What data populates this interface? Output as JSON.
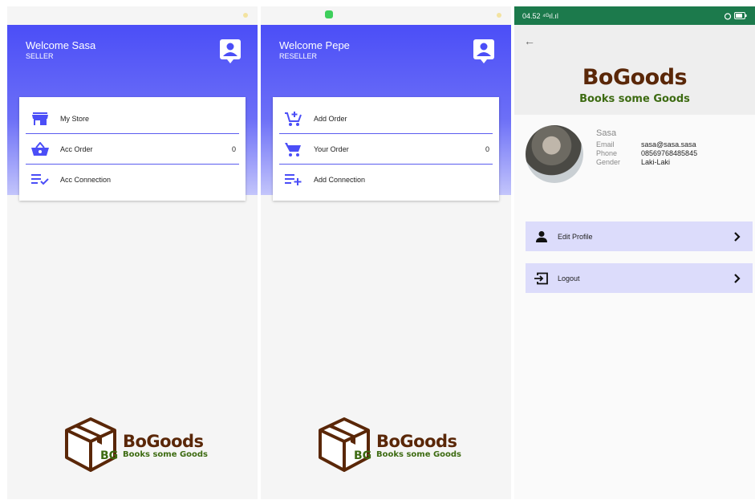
{
  "seller_screen": {
    "welcome": "Welcome Sasa",
    "role": "SELLER",
    "menu": [
      {
        "label": "My Store",
        "icon": "store-icon"
      },
      {
        "label": "Acc Order",
        "icon": "basket-icon",
        "count": "0"
      },
      {
        "label": "Acc Connection",
        "icon": "playlist-check-icon"
      }
    ]
  },
  "reseller_screen": {
    "welcome": "Welcome Pepe",
    "role": "RESELLER",
    "menu": [
      {
        "label": "Add Order",
        "icon": "cart-plus-icon"
      },
      {
        "label": "Your Order",
        "icon": "cart-icon",
        "count": "0"
      },
      {
        "label": "Add Connection",
        "icon": "playlist-add-icon"
      }
    ]
  },
  "logo": {
    "brand": "BoGoods",
    "tagline": "Books some Goods",
    "box_letters": "BG"
  },
  "profile_screen": {
    "status_time": "04.52",
    "status_signal": "⁴ᴳıl.ıl",
    "brand": "BoGoods",
    "tagline": "Books some Goods",
    "name": "Sasa",
    "fields": [
      {
        "label": "Email",
        "value": "sasa@sasa.sasa"
      },
      {
        "label": "Phone",
        "value": "08569768485845"
      },
      {
        "label": "Gender",
        "value": "Laki-Laki"
      }
    ],
    "menu": [
      {
        "label": "Edit Profile",
        "icon": "person-icon"
      },
      {
        "label": "Logout",
        "icon": "logout-icon"
      }
    ]
  },
  "colors": {
    "accent": "#4b4ef7",
    "brand_brown": "#5a2708",
    "brand_green": "#3d6b12",
    "status_green": "#1c7a4c",
    "menu_bg": "#dcdcfb"
  }
}
